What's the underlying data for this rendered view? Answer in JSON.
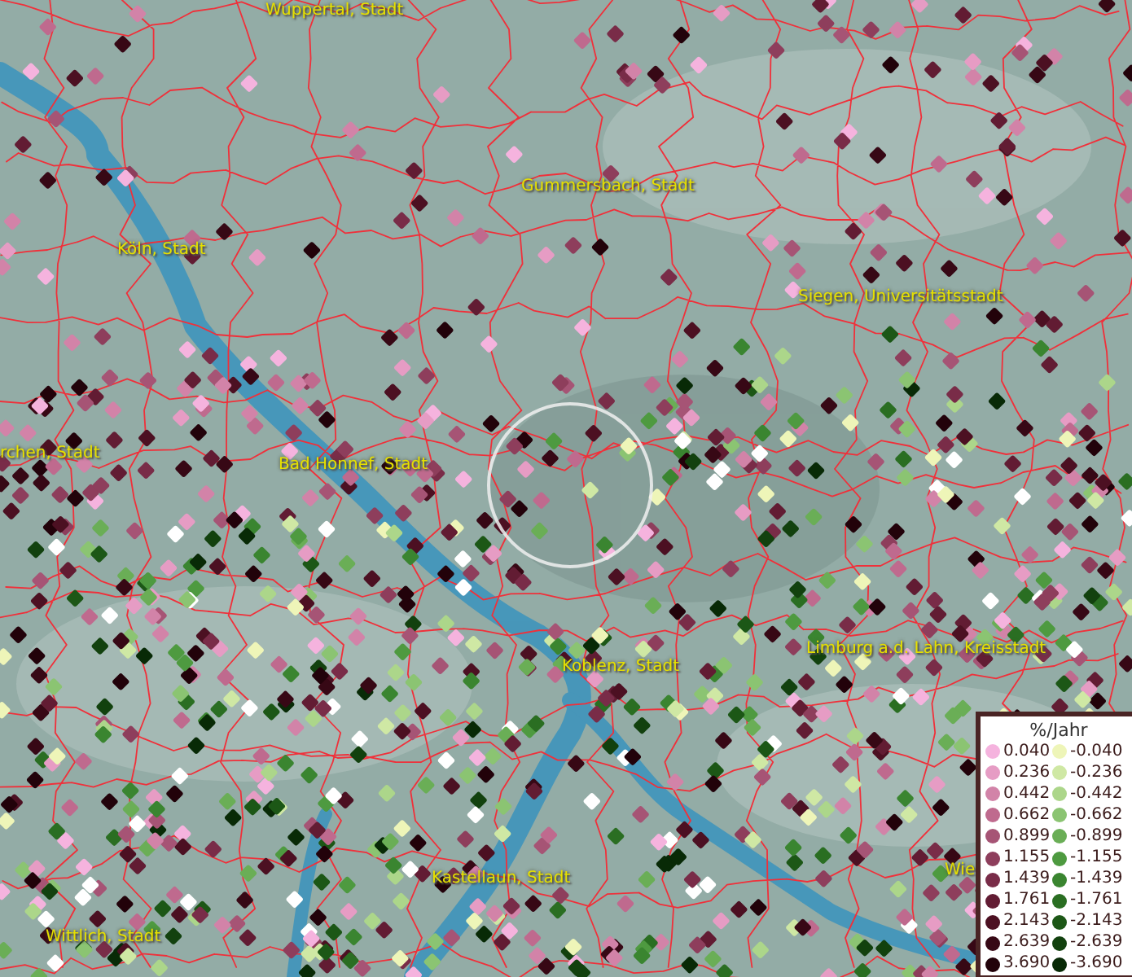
{
  "map": {
    "places": [
      {
        "name": "Wuppertal, Stadt"
      },
      {
        "name": "Gummersbach, Stadt"
      },
      {
        "name": "Köln, Stadt"
      },
      {
        "name": "Siegen, Universitätsstadt"
      },
      {
        "name": "rchen, Stadt"
      },
      {
        "name": "Bad Honnef, Stadt"
      },
      {
        "name": "Koblenz, Stadt"
      },
      {
        "name": "Limburg a.d. Lahn, Kreisstadt"
      },
      {
        "name": "Kastellaun, Stadt"
      },
      {
        "name": "Wittlich, Stadt"
      },
      {
        "name": "Wie"
      }
    ]
  },
  "legend": {
    "title": "%/Jahr",
    "positive": [
      {
        "label": "0.040",
        "color": "#f5b3de"
      },
      {
        "label": "0.236",
        "color": "#e69cc4"
      },
      {
        "label": "0.442",
        "color": "#d283a8"
      },
      {
        "label": "0.662",
        "color": "#bf6a8e"
      },
      {
        "label": "0.899",
        "color": "#a65475"
      },
      {
        "label": "1.155",
        "color": "#8e3e5c"
      },
      {
        "label": "1.439",
        "color": "#792c48"
      },
      {
        "label": "1.761",
        "color": "#621c33"
      },
      {
        "label": "2.143",
        "color": "#4c1022"
      },
      {
        "label": "2.639",
        "color": "#370815"
      },
      {
        "label": "3.690",
        "color": "#22020a"
      }
    ],
    "negative": [
      {
        "label": "-0.040",
        "color": "#eef5b8"
      },
      {
        "label": "-0.236",
        "color": "#cfe8a4"
      },
      {
        "label": "-0.442",
        "color": "#acd68a"
      },
      {
        "label": "-0.662",
        "color": "#8bc472"
      },
      {
        "label": "-0.899",
        "color": "#6aae56"
      },
      {
        "label": "-1.155",
        "color": "#4e9a40"
      },
      {
        "label": "-1.439",
        "color": "#3a8530"
      },
      {
        "label": "-1.761",
        "color": "#2a6e22"
      },
      {
        "label": "-2.143",
        "color": "#1c5716"
      },
      {
        "label": "-2.639",
        "color": "#12410e"
      },
      {
        "label": "-3.690",
        "color": "#082a06"
      }
    ]
  }
}
